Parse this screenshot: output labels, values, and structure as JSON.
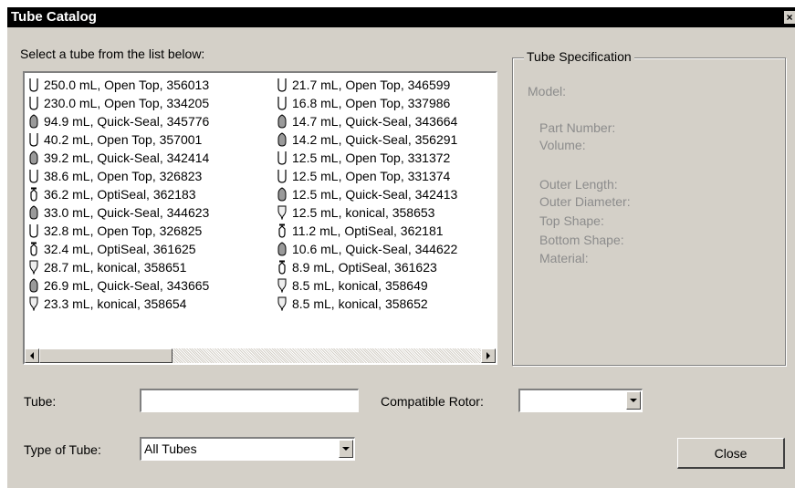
{
  "window": {
    "title": "Tube Catalog",
    "close_glyph": "×"
  },
  "prompt": "Select a tube from the list below:",
  "tubes": [
    [
      {
        "text": "250.0 mL, Open Top, 356013",
        "icon": "open-top"
      },
      {
        "text": "230.0 mL, Open Top, 334205",
        "icon": "open-top"
      },
      {
        "text": "94.9 mL, Quick-Seal, 345776",
        "icon": "quick-seal"
      },
      {
        "text": "40.2 mL, Open Top, 357001",
        "icon": "open-top"
      },
      {
        "text": "39.2 mL, Quick-Seal, 342414",
        "icon": "quick-seal"
      },
      {
        "text": "38.6 mL, Open Top, 326823",
        "icon": "open-top"
      },
      {
        "text": "36.2 mL, OptiSeal, 362183",
        "icon": "optiseal"
      },
      {
        "text": "33.0 mL, Quick-Seal, 344623",
        "icon": "quick-seal"
      },
      {
        "text": "32.8 mL, Open Top, 326825",
        "icon": "open-top"
      },
      {
        "text": "32.4 mL, OptiSeal, 361625",
        "icon": "optiseal"
      },
      {
        "text": "28.7 mL, konical, 358651",
        "icon": "konical"
      },
      {
        "text": "26.9 mL, Quick-Seal, 343665",
        "icon": "quick-seal"
      },
      {
        "text": "23.3 mL, konical, 358654",
        "icon": "konical"
      }
    ],
    [
      {
        "text": "21.7 mL, Open Top, 346599",
        "icon": "open-top"
      },
      {
        "text": "16.8 mL, Open Top, 337986",
        "icon": "open-top"
      },
      {
        "text": "14.7 mL, Quick-Seal, 343664",
        "icon": "quick-seal"
      },
      {
        "text": "14.2 mL, Quick-Seal, 356291",
        "icon": "quick-seal"
      },
      {
        "text": "12.5 mL, Open Top, 331372",
        "icon": "open-top"
      },
      {
        "text": "12.5 mL, Open Top, 331374",
        "icon": "open-top"
      },
      {
        "text": "12.5 mL, Quick-Seal, 342413",
        "icon": "quick-seal"
      },
      {
        "text": "12.5 mL, konical, 358653",
        "icon": "konical"
      },
      {
        "text": "11.2 mL, OptiSeal, 362181",
        "icon": "optiseal"
      },
      {
        "text": "10.6 mL, Quick-Seal, 344622",
        "icon": "quick-seal"
      },
      {
        "text": "8.9 mL, OptiSeal, 361623",
        "icon": "optiseal"
      },
      {
        "text": "8.5 mL, konical, 358649",
        "icon": "konical"
      },
      {
        "text": "8.5 mL, konical, 358652",
        "icon": "konical"
      }
    ]
  ],
  "spec": {
    "legend": "Tube Specification",
    "model": "Model:",
    "part_number": "Part Number:",
    "volume": "Volume:",
    "outer_length": "Outer Length:",
    "outer_diameter": "Outer Diameter:",
    "top_shape": "Top Shape:",
    "bottom_shape": "Bottom Shape:",
    "material": "Material:"
  },
  "form": {
    "tube_label": "Tube:",
    "tube_value": "",
    "rotor_label": "Compatible Rotor:",
    "rotor_value": "",
    "type_label": "Type of Tube:",
    "type_value": "All Tubes"
  },
  "buttons": {
    "close": "Close"
  },
  "colors": {
    "face": "#d4d0c8",
    "disabled_text": "#8c8c8c",
    "titlebar": "#000000"
  }
}
